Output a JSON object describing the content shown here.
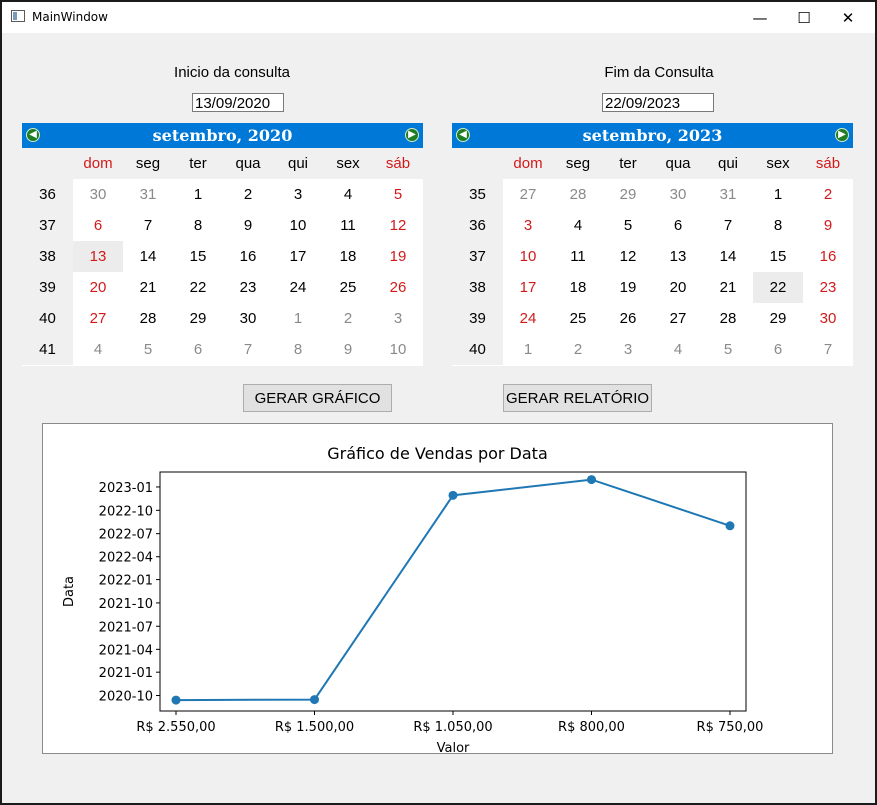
{
  "window": {
    "title": "MainWindow",
    "minimize": "—",
    "maximize": "☐",
    "close": "✕"
  },
  "start": {
    "label": "Inicio da consulta",
    "date_value": "13/09/2020",
    "month_title": "setembro,  2020",
    "weekdays": [
      "dom",
      "seg",
      "ter",
      "qua",
      "qui",
      "sex",
      "sáb"
    ],
    "weeks": [
      {
        "wk": "36",
        "days": [
          "30",
          "31",
          "1",
          "2",
          "3",
          "4",
          "5"
        ]
      },
      {
        "wk": "37",
        "days": [
          "6",
          "7",
          "8",
          "9",
          "10",
          "11",
          "12"
        ]
      },
      {
        "wk": "38",
        "days": [
          "13",
          "14",
          "15",
          "16",
          "17",
          "18",
          "19"
        ]
      },
      {
        "wk": "39",
        "days": [
          "20",
          "21",
          "22",
          "23",
          "24",
          "25",
          "26"
        ]
      },
      {
        "wk": "40",
        "days": [
          "27",
          "28",
          "29",
          "30",
          "1",
          "2",
          "3"
        ]
      },
      {
        "wk": "41",
        "days": [
          "4",
          "5",
          "6",
          "7",
          "8",
          "9",
          "10"
        ]
      }
    ],
    "selected_day": "13"
  },
  "end": {
    "label": "Fim da Consulta",
    "date_value": "22/09/2023",
    "month_title": "setembro,  2023",
    "weekdays": [
      "dom",
      "seg",
      "ter",
      "qua",
      "qui",
      "sex",
      "sáb"
    ],
    "weeks": [
      {
        "wk": "35",
        "days": [
          "27",
          "28",
          "29",
          "30",
          "31",
          "1",
          "2"
        ]
      },
      {
        "wk": "36",
        "days": [
          "3",
          "4",
          "5",
          "6",
          "7",
          "8",
          "9"
        ]
      },
      {
        "wk": "37",
        "days": [
          "10",
          "11",
          "12",
          "13",
          "14",
          "15",
          "16"
        ]
      },
      {
        "wk": "38",
        "days": [
          "17",
          "18",
          "19",
          "20",
          "21",
          "22",
          "23"
        ]
      },
      {
        "wk": "39",
        "days": [
          "24",
          "25",
          "26",
          "27",
          "28",
          "29",
          "30"
        ]
      },
      {
        "wk": "40",
        "days": [
          "1",
          "2",
          "3",
          "4",
          "5",
          "6",
          "7"
        ]
      }
    ],
    "selected_day": "22"
  },
  "buttons": {
    "chart": "GERAR GRÁFICO",
    "report": "GERAR RELATÓRIO"
  },
  "chart_data": {
    "type": "line",
    "title": "Gráfico de Vendas por Data",
    "xlabel": "Valor",
    "ylabel": "Data",
    "categories": [
      "R$ 2.550,00",
      "R$ 1.500,00",
      "R$ 1.050,00",
      "R$ 800,00",
      "R$ 750,00"
    ],
    "values": [
      "2020-09-13",
      "2020-09-15",
      "2022-11-29",
      "2023-01-30",
      "2022-08-01"
    ],
    "y_ticks": [
      "2020-10",
      "2021-01",
      "2021-04",
      "2021-07",
      "2021-10",
      "2022-01",
      "2022-04",
      "2022-07",
      "2022-10",
      "2023-01"
    ],
    "ylim": [
      "2020-08-01",
      "2023-03-01"
    ],
    "color": "#1f77b4",
    "grid": false
  }
}
